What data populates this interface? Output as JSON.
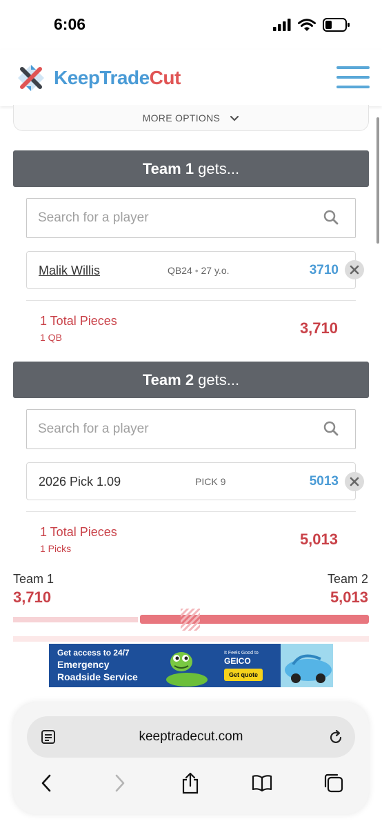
{
  "status_bar": {
    "time": "6:06"
  },
  "header": {
    "brand_part1": "Keep",
    "brand_part2": "Trade",
    "brand_part3": "Cut"
  },
  "more_options": {
    "label": "MORE OPTIONS"
  },
  "team1": {
    "title_bold": "Team 1",
    "title_rest": " gets...",
    "search_placeholder": "Search for a player",
    "player": {
      "name": "Malik Willis",
      "position": "QB24",
      "separator": "•",
      "age": "27 y.o.",
      "value": "3710"
    },
    "pieces_label": "1 Total Pieces",
    "pieces_sub": "1 QB",
    "total": "3,710"
  },
  "team2": {
    "title_bold": "Team 2",
    "title_rest": " gets...",
    "search_placeholder": "Search for a player",
    "player": {
      "name": "2026 Pick 1.09",
      "info": "PICK 9",
      "value": "5013"
    },
    "pieces_label": "1 Total Pieces",
    "pieces_sub": "1 Picks",
    "total": "5,013"
  },
  "comparison": {
    "team1_label": "Team 1",
    "team1_value": "3,710",
    "team2_label": "Team 2",
    "team2_value": "5,013",
    "team1_share": 0.35,
    "team2_share": 0.65
  },
  "ad": {
    "line1": "Get access to 24/7",
    "line2": "Emergency",
    "line3": "Roadside Service",
    "tagline": "It Feels Good to",
    "brand": "GEICO",
    "cta": "Get quote"
  },
  "browser": {
    "url": "keeptradecut.com"
  },
  "colors": {
    "accent_blue": "#4a9bd6",
    "accent_red": "#c94148",
    "team_bar": "#5f6369"
  }
}
